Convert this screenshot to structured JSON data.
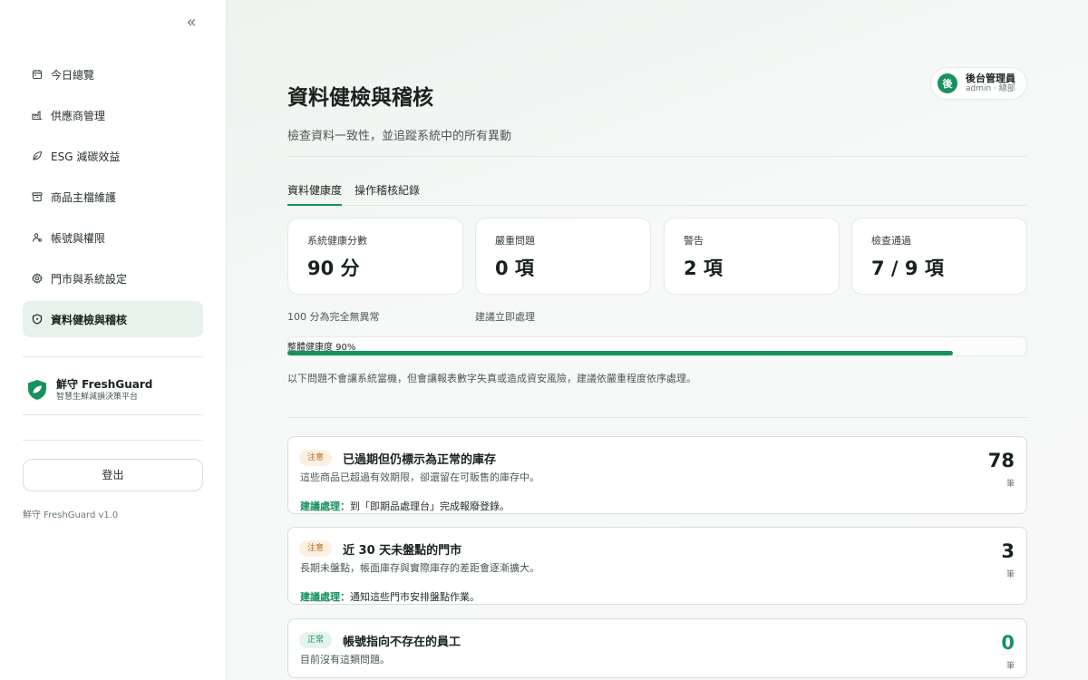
{
  "sidebar": {
    "collapse_glyph": "«",
    "items": [
      {
        "label": "今日總覽",
        "icon": "calendar-icon"
      },
      {
        "label": "供應商管理",
        "icon": "factory-icon"
      },
      {
        "label": "ESG 減碳效益",
        "icon": "leaf-icon"
      },
      {
        "label": "商品主檔維護",
        "icon": "archive-icon"
      },
      {
        "label": "帳號與權限",
        "icon": "users-icon"
      },
      {
        "label": "門市與系統設定",
        "icon": "gear-icon"
      },
      {
        "label": "資料健檢與稽核",
        "icon": "shield-icon",
        "active": true
      }
    ],
    "brand": {
      "name": "鮮守 FreshGuard",
      "tagline": "智慧生鮮減損決策平台"
    },
    "logout_label": "登出",
    "version": "鮮守 FreshGuard v1.0"
  },
  "user": {
    "avatar_char": "後",
    "name": "後台管理員",
    "sub": "admin · 總部"
  },
  "page": {
    "title": "資料健檢與稽核",
    "subtitle": "檢查資料一致性，並追蹤系統中的所有異動"
  },
  "tabs": [
    {
      "label": "資料健康度",
      "active": true
    },
    {
      "label": "操作稽核紀錄",
      "active": false
    }
  ],
  "stats": [
    {
      "label": "系統健康分數",
      "value": "90 分"
    },
    {
      "label": "嚴重問題",
      "value": "0 項"
    },
    {
      "label": "警告",
      "value": "2 項"
    },
    {
      "label": "檢查通過",
      "value": "7 / 9 項"
    }
  ],
  "stat_notes": {
    "score": "100 分為完全無異常",
    "severe": "建議立即處理"
  },
  "health": {
    "label": "整體健康度 90%",
    "percent": 90
  },
  "health_note": "以下問題不會讓系統當機，但會讓報表數字失真或造成資安風險，建議依嚴重程度依序處理。",
  "issues": [
    {
      "badge": "注意",
      "status": "warn",
      "title": "已過期但仍標示為正常的庫存",
      "desc": "這些商品已超過有效期限，卻還留在可販售的庫存中。",
      "action_key": "建議處理：",
      "action": "到「即期品處理台」完成報廢登錄。",
      "count": "78",
      "unit": "筆"
    },
    {
      "badge": "注意",
      "status": "warn",
      "title": "近 30 天未盤點的門市",
      "desc": "長期未盤點，帳面庫存與實際庫存的差距會逐漸擴大。",
      "action_key": "建議處理：",
      "action": "通知這些門市安排盤點作業。",
      "count": "3",
      "unit": "筆"
    },
    {
      "badge": "正常",
      "status": "ok",
      "title": "帳號指向不存在的員工",
      "desc": "目前沒有這類問題。",
      "count": "0",
      "unit": "筆"
    }
  ],
  "colors": {
    "accent": "#16925d",
    "warn_bg": "#fdf0e2",
    "warn_text": "#b8671b",
    "active_nav": "#e7f2ec"
  }
}
